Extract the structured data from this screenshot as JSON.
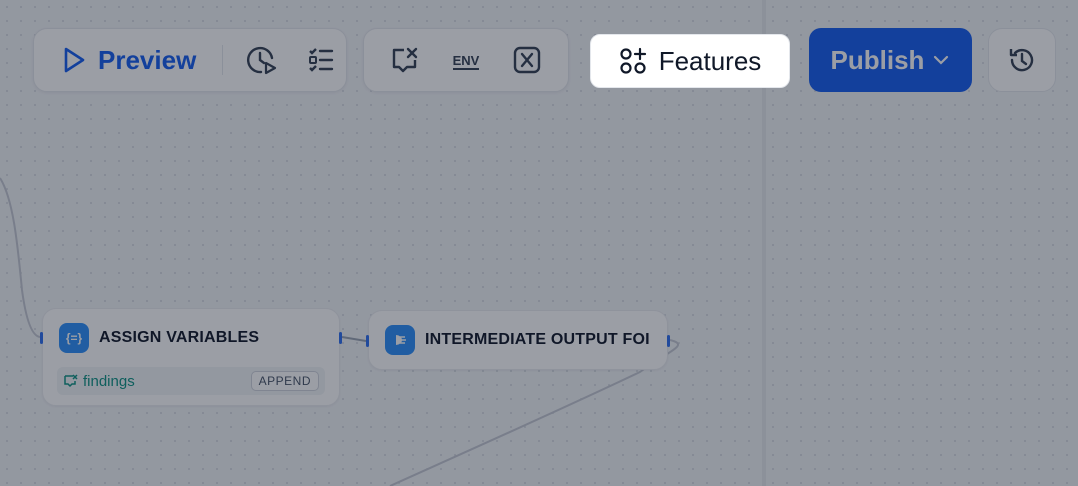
{
  "toolbar": {
    "preview_label": "Preview",
    "run_history_icon": "clock-play-icon",
    "checklist_icon": "checklist-icon",
    "conversation_variables_icon": "chat-variable-icon",
    "env_label": "ENV",
    "variable_icon": "variable-x-icon"
  },
  "features": {
    "label": "Features",
    "icon": "apps-plus-icon"
  },
  "publish": {
    "label": "Publish",
    "icon": "chevron-down-icon"
  },
  "history": {
    "icon": "history-icon"
  },
  "nodes": {
    "assign": {
      "icon_text": "{=}",
      "title": "ASSIGN VARIABLES",
      "variable": "findings",
      "operation": "APPEND"
    },
    "intermediate": {
      "title": "INTERMEDIATE OUTPUT FOI"
    }
  },
  "colors": {
    "accent": "#155eef",
    "overlay": "rgba(16,24,40,0.42)",
    "variable_text": "#0e9384"
  }
}
